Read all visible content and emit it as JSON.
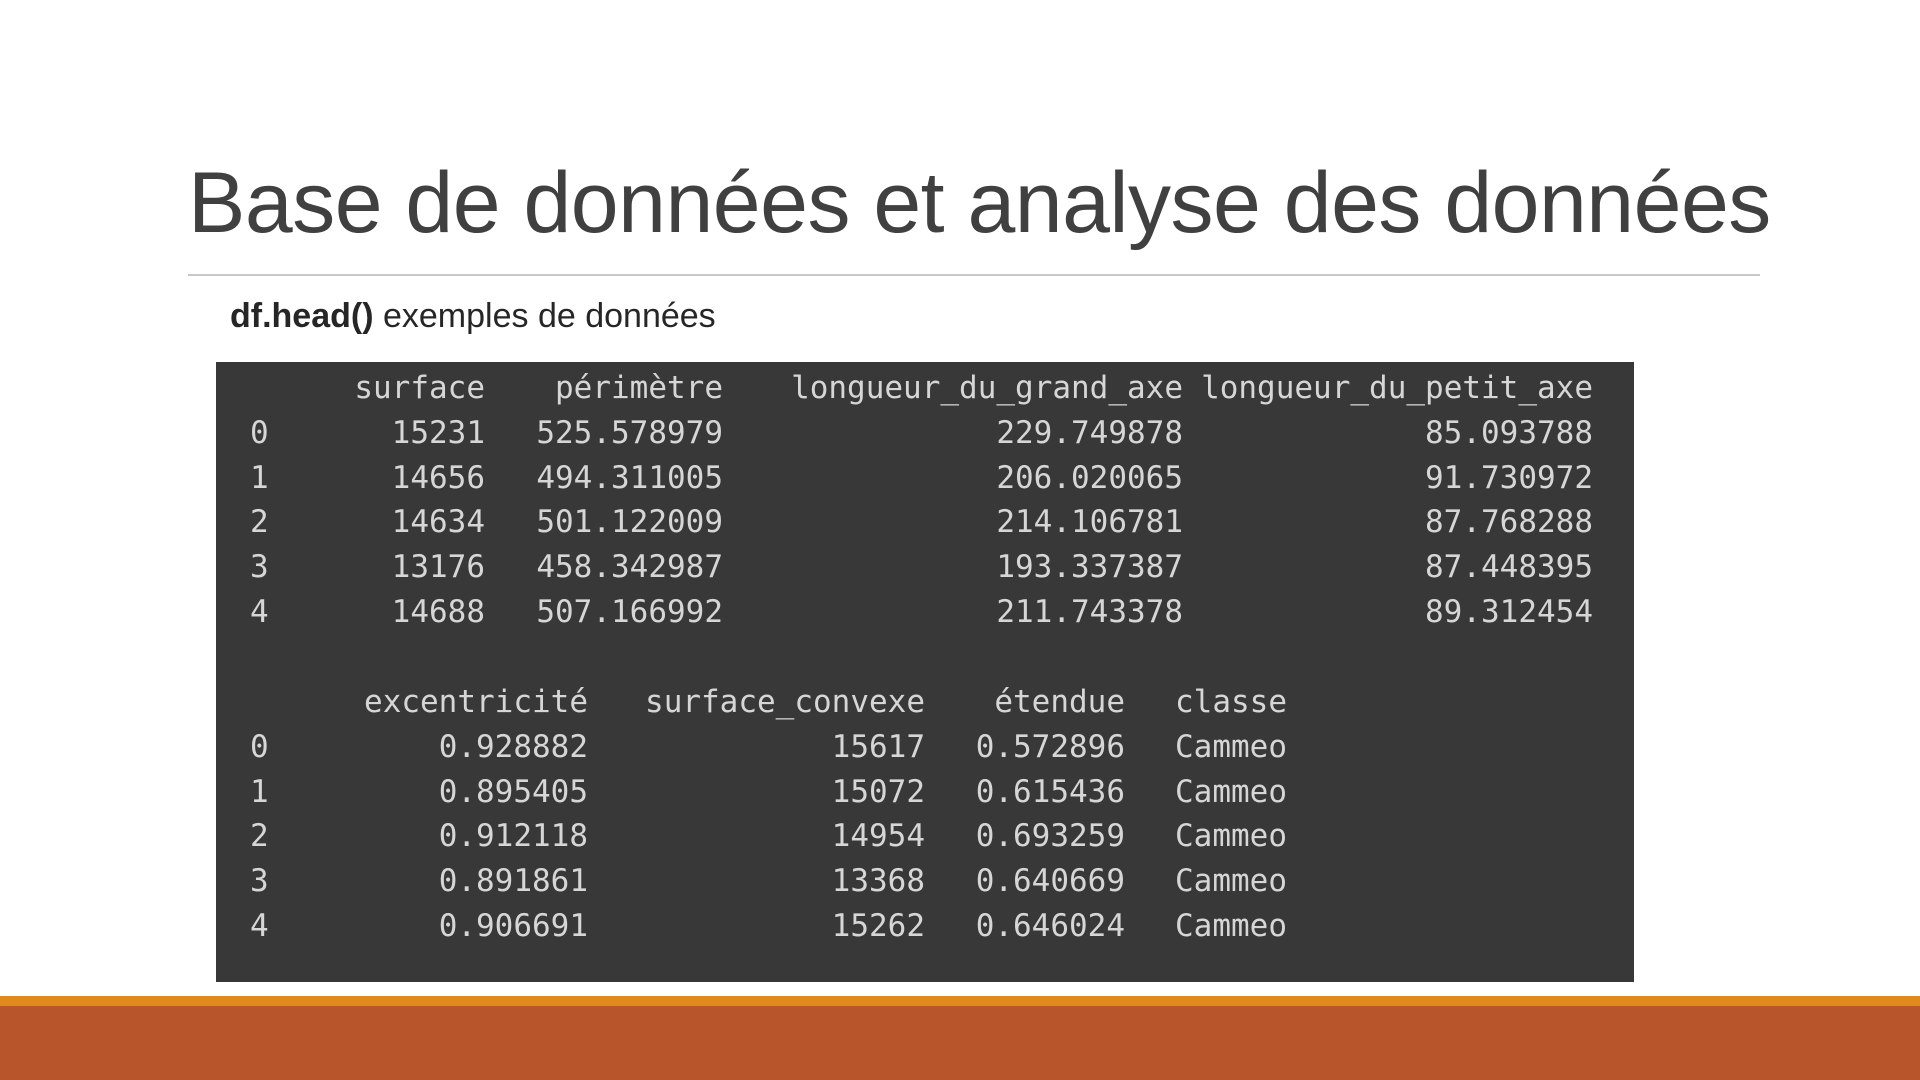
{
  "slide": {
    "title": "Base de données et analyse des données",
    "subtitle_code": "df.head()",
    "subtitle_text": " exemples de données"
  },
  "table1": {
    "columns": [
      "surface",
      "périmètre",
      "longueur_du_grand_axe",
      "longueur_du_petit_axe"
    ],
    "rows": [
      {
        "index": "0",
        "values": [
          "15231",
          "525.578979",
          "229.749878",
          "85.093788"
        ]
      },
      {
        "index": "1",
        "values": [
          "14656",
          "494.311005",
          "206.020065",
          "91.730972"
        ]
      },
      {
        "index": "2",
        "values": [
          "14634",
          "501.122009",
          "214.106781",
          "87.768288"
        ]
      },
      {
        "index": "3",
        "values": [
          "13176",
          "458.342987",
          "193.337387",
          "87.448395"
        ]
      },
      {
        "index": "4",
        "values": [
          "14688",
          "507.166992",
          "211.743378",
          "89.312454"
        ]
      }
    ]
  },
  "table2": {
    "columns": [
      "excentricité",
      "surface_convexe",
      "étendue",
      "classe"
    ],
    "rows": [
      {
        "index": "0",
        "values": [
          "0.928882",
          "15617",
          "0.572896",
          "Cammeo"
        ]
      },
      {
        "index": "1",
        "values": [
          "0.895405",
          "15072",
          "0.615436",
          "Cammeo"
        ]
      },
      {
        "index": "2",
        "values": [
          "0.912118",
          "14954",
          "0.693259",
          "Cammeo"
        ]
      },
      {
        "index": "3",
        "values": [
          "0.891861",
          "13368",
          "0.640669",
          "Cammeo"
        ]
      },
      {
        "index": "4",
        "values": [
          "0.906691",
          "15262",
          "0.646024",
          "Cammeo"
        ]
      }
    ]
  },
  "colors": {
    "console_bg": "#383838",
    "console_text": "#d6d6d6",
    "footer_stripe": "#e08a1e",
    "footer_bar": "#b9552a"
  }
}
